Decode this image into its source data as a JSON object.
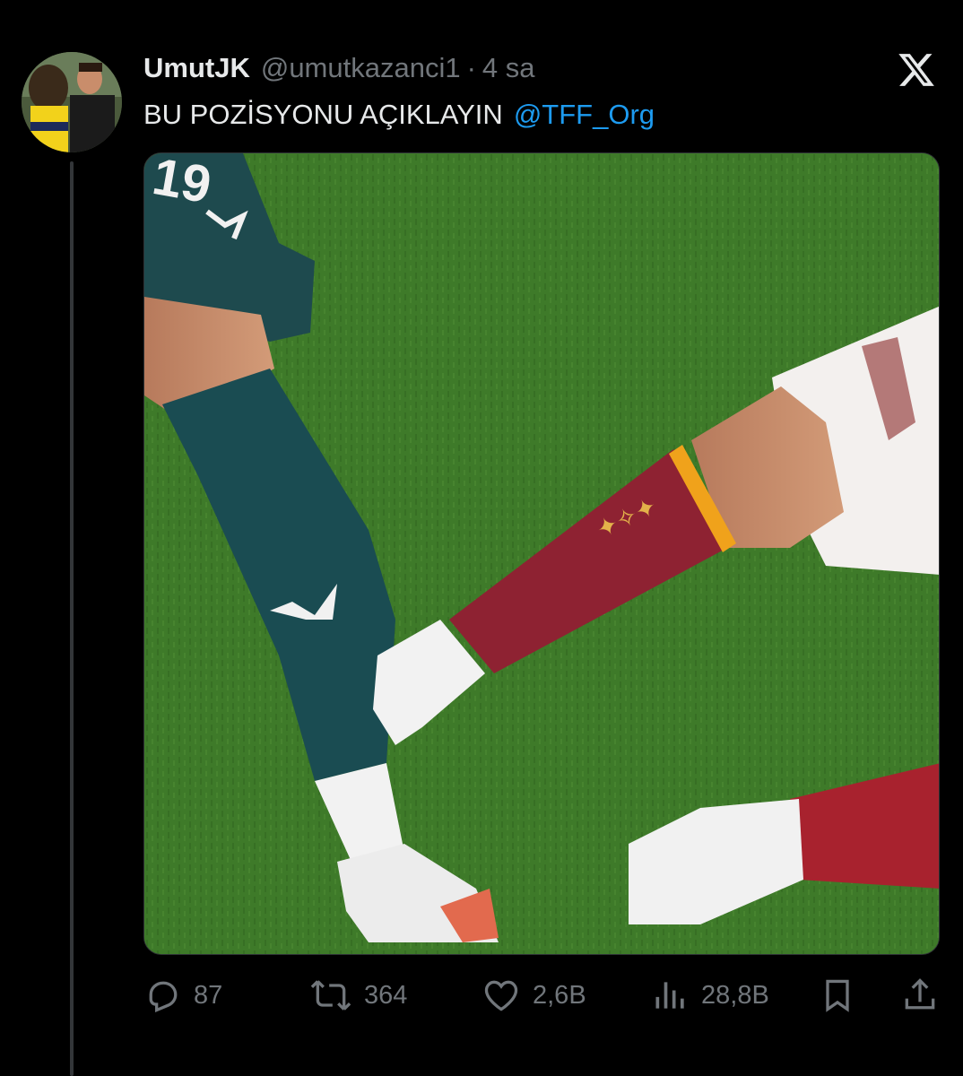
{
  "tweet": {
    "display_name": "UmutJK",
    "handle": "@umutkazanci1",
    "separator": "·",
    "time": "4 sa",
    "text": "BU POZİSYONU AÇIKLAYIN",
    "mention": "@TFF_Org"
  },
  "media": {
    "jersey_number": "19",
    "icon": "photo-football-tackle"
  },
  "actions": {
    "replies": "87",
    "reposts": "364",
    "likes": "2,6B",
    "views": "28,8B"
  },
  "icons": {
    "brand": "x-logo-icon",
    "reply": "reply-icon",
    "repost": "repost-icon",
    "like": "like-icon",
    "views": "views-icon",
    "bookmark": "bookmark-icon",
    "share": "share-icon"
  },
  "colors": {
    "background": "#000000",
    "text_primary": "#e7e9ea",
    "text_secondary": "#71767b",
    "link": "#1d9bf0"
  }
}
